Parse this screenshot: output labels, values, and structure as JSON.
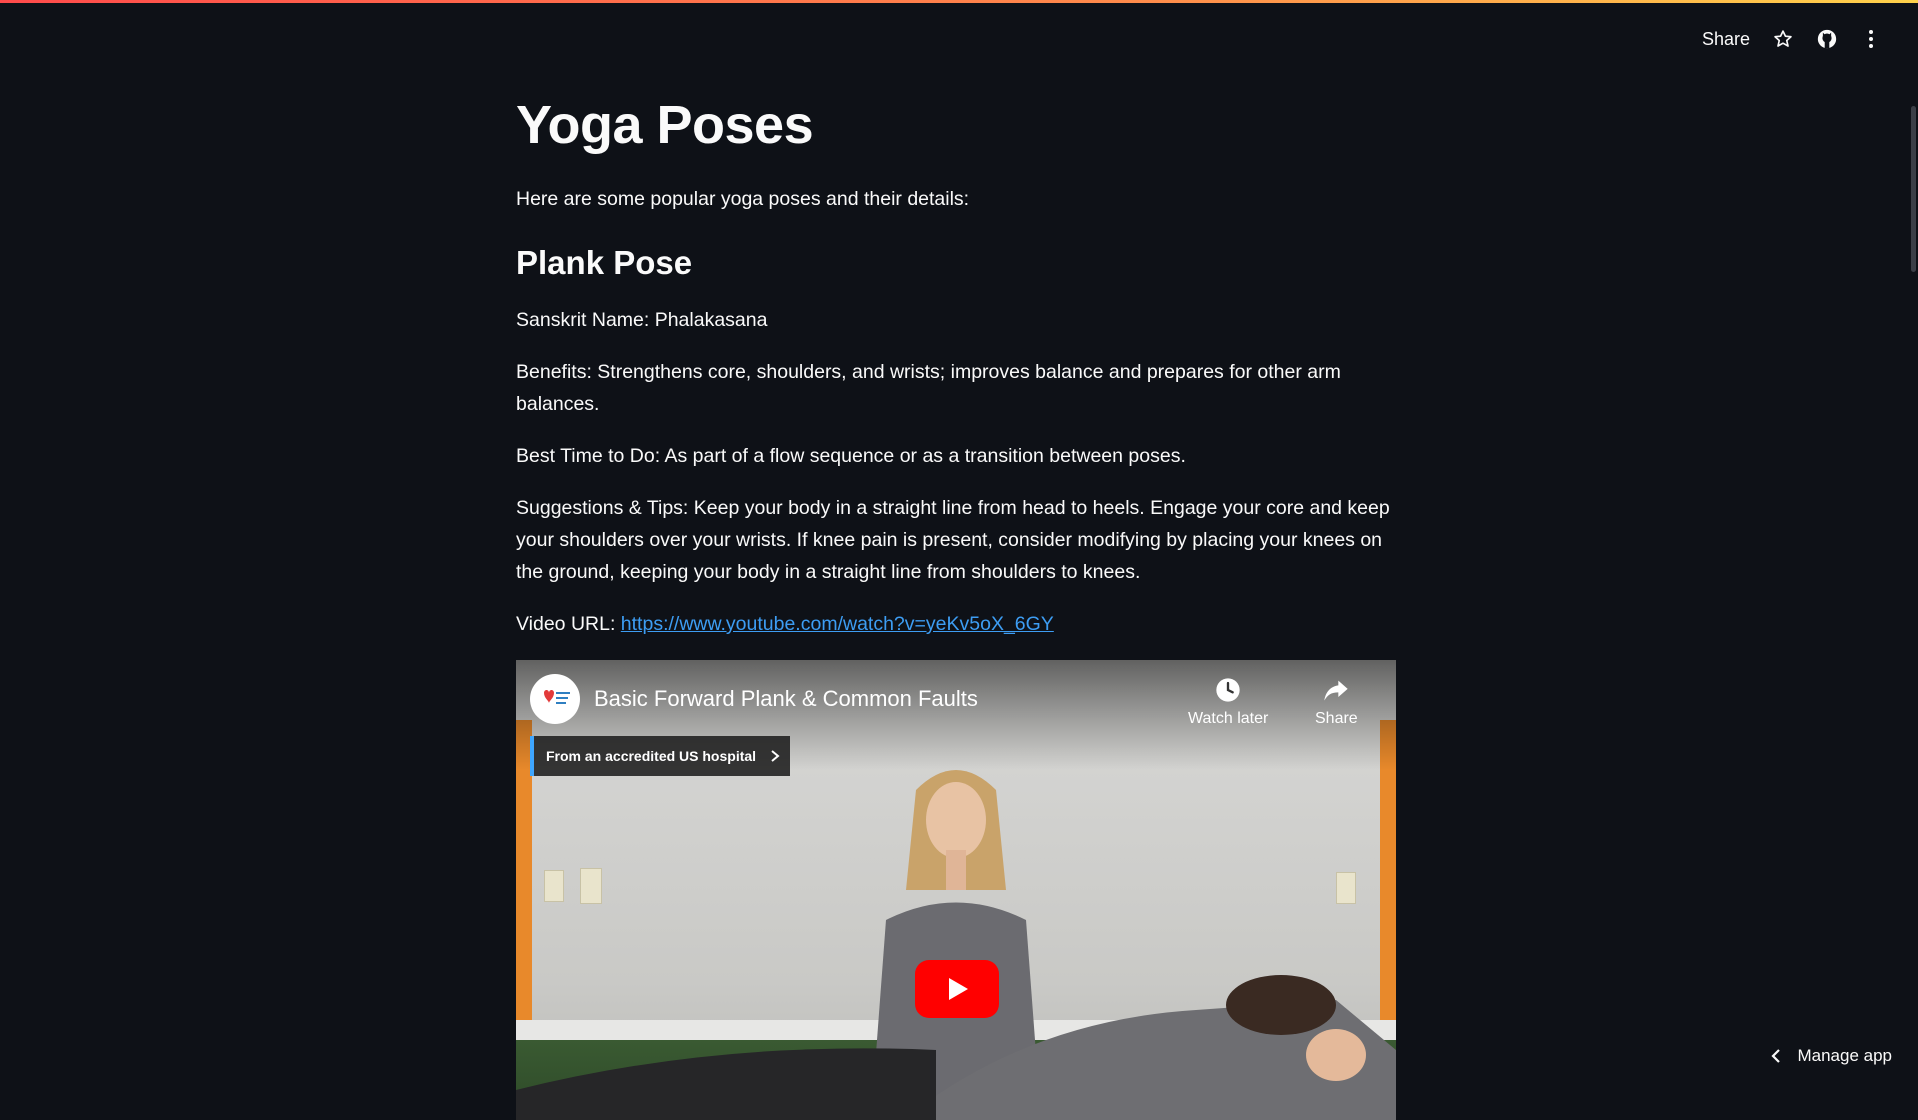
{
  "toolbar": {
    "share_label": "Share",
    "icons": [
      "star-icon",
      "github-icon",
      "more-vertical-icon"
    ]
  },
  "page": {
    "title": "Yoga Poses",
    "intro": "Here are some popular yoga poses and their details:"
  },
  "pose": {
    "name": "Plank Pose",
    "sanskrit": "Sanskrit Name: Phalakasana",
    "benefits": "Benefits: Strengthens core, shoulders, and wrists; improves balance and prepares for other arm balances.",
    "best_time": "Best Time to Do: As part of a flow sequence or as a transition between poses.",
    "tips": "Suggestions & Tips: Keep your body in a straight line from head to heels. Engage your core and keep your shoulders over your wrists. If knee pain is present, consider modifying by placing your knees on the ground, keeping your body in a straight line from shoulders to knees.",
    "video_label": "Video URL: ",
    "video_url": "https://www.youtube.com/watch?v=yeKv5oX_6GY"
  },
  "video": {
    "title": "Basic Forward Plank & Common Faults",
    "watch_later": "Watch later",
    "share": "Share",
    "banner": "From an accredited US hospital"
  },
  "footer": {
    "manage_app": "Manage app"
  },
  "colors": {
    "background": "#0e1117",
    "link": "#3d9df3",
    "play_button": "#ff0000"
  }
}
